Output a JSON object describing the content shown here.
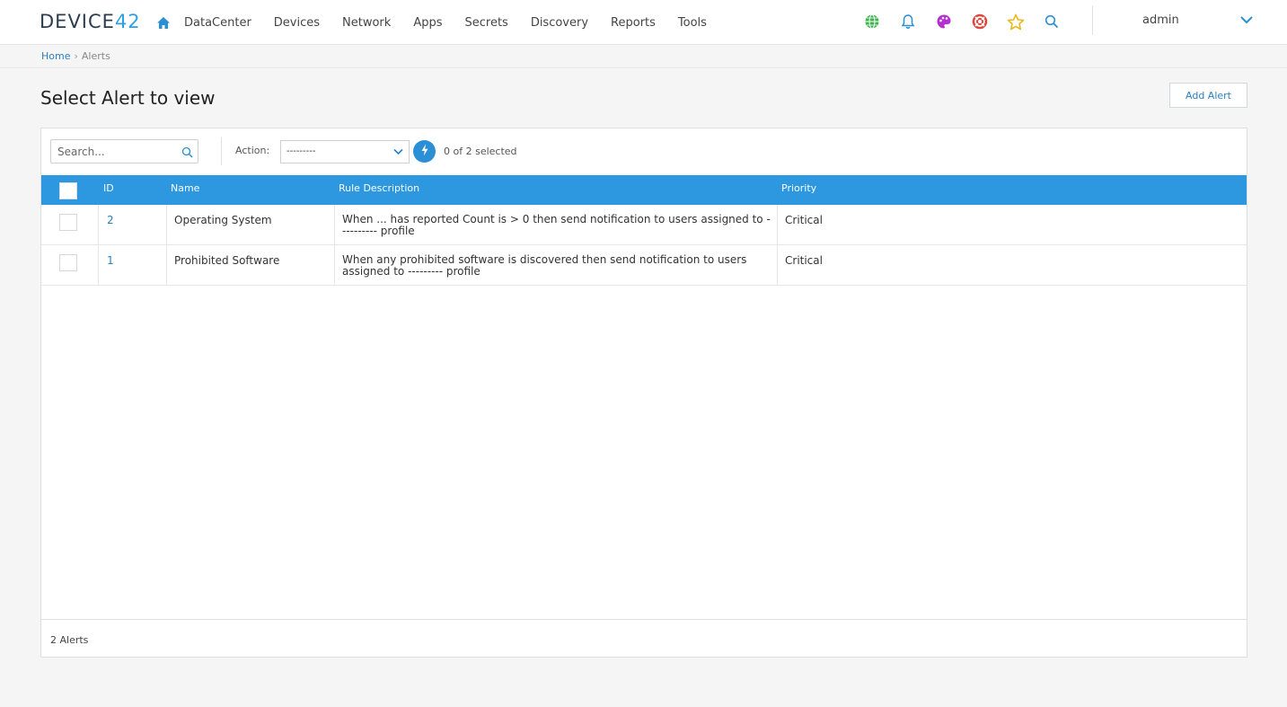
{
  "brand": {
    "text": "DEVICE",
    "num": "42"
  },
  "nav": {
    "items": [
      "DataCenter",
      "Devices",
      "Network",
      "Apps",
      "Secrets",
      "Discovery",
      "Reports",
      "Tools"
    ]
  },
  "user": {
    "name": "admin"
  },
  "breadcrumb": {
    "home": "Home",
    "sep": "›",
    "current": "Alerts"
  },
  "page": {
    "title": "Select Alert to view",
    "add_button": "Add Alert"
  },
  "toolbar": {
    "search_placeholder": "Search...",
    "action_label": "Action:",
    "action_value": "---------",
    "selected_text": "0 of 2 selected"
  },
  "table": {
    "headers": {
      "id": "ID",
      "name": "Name",
      "rule": "Rule Description",
      "priority": "Priority"
    },
    "rows": [
      {
        "id": "2",
        "name": "Operating System",
        "rule": "When ... has reported Count is > 0 then send notification to users assigned to ---------- profile",
        "priority": "Critical"
      },
      {
        "id": "1",
        "name": "Prohibited Software",
        "rule": "When any prohibited software is discovered then send notification to users assigned to --------- profile",
        "priority": "Critical"
      }
    ]
  },
  "footer": {
    "total": "2 Alerts"
  },
  "colors": {
    "accent": "#2d97e0",
    "link": "#2a7fc0",
    "brand": "#2b3d4f"
  }
}
